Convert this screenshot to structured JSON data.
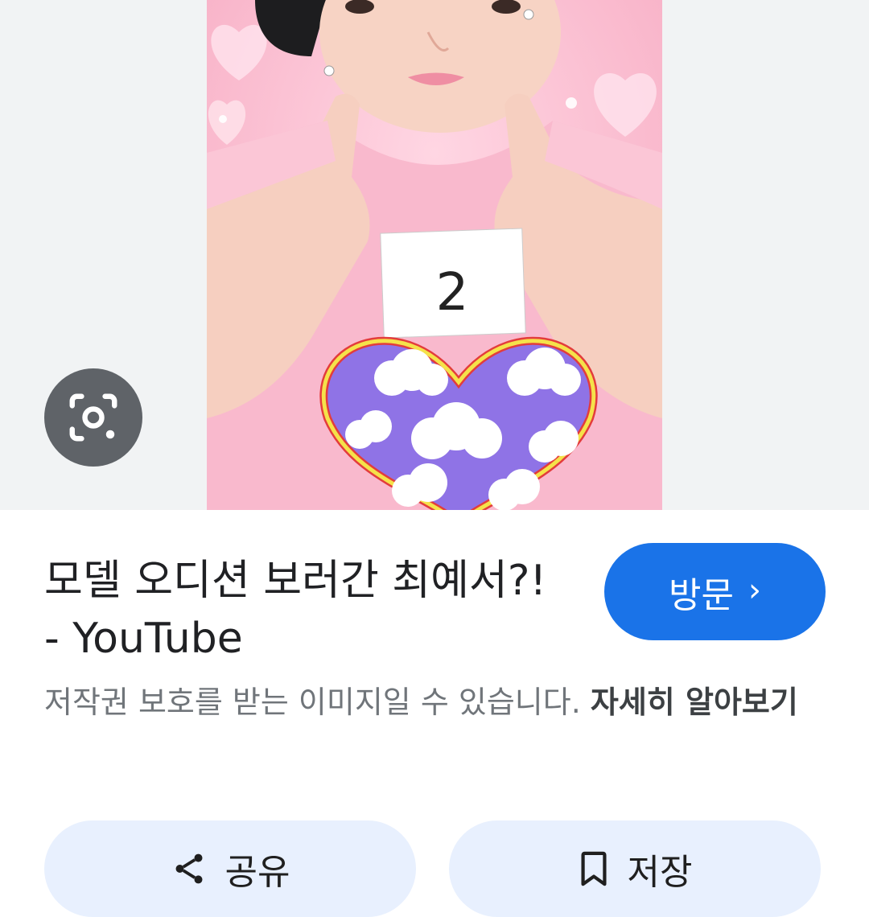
{
  "result": {
    "title": "모델 오디션 보러간 최예서?! - YouTube",
    "visit_label": "방문",
    "copyright_notice": "저작권 보호를 받는 이미지일 수 있습니다.",
    "learn_more": "자세히 알아보기"
  },
  "photo": {
    "number_card": "2"
  },
  "actions": {
    "share_label": "공유",
    "save_label": "저장"
  },
  "icons": {
    "lens": "google-lens-icon",
    "share": "share-icon",
    "save": "bookmark-icon",
    "visit_arrow": "chevron-right-icon"
  },
  "colors": {
    "accent": "#1a73e8",
    "lens_button": "#5f6368",
    "action_bg": "#e8f0fe",
    "title_text": "#202124",
    "muted_text": "#70757a"
  }
}
